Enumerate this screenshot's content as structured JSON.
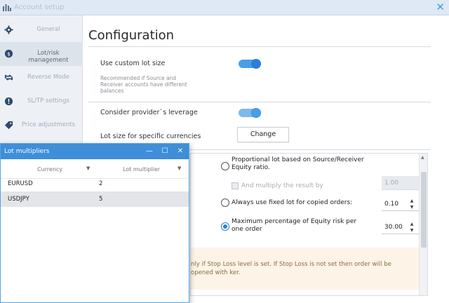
{
  "window": {
    "title": "Account setup",
    "close_glyph": "✕",
    "app_icon": "bars-logo-icon",
    "close_color": "#39a0f0"
  },
  "sidebar": {
    "items": [
      {
        "label": "General",
        "icon": "gear-icon"
      },
      {
        "label": "Lot/risk management",
        "icon": "dollar-coin-icon",
        "active": true
      },
      {
        "label": "Reverse Mode",
        "icon": "reverse-arrows-icon"
      },
      {
        "label": "SL/TP settings",
        "icon": "alert-circle-icon"
      },
      {
        "label": "Price adjustments",
        "icon": "tag-icon"
      }
    ]
  },
  "main": {
    "title": "Configuration",
    "use_custom_lot": {
      "label": "Use custom lot size",
      "hint": "Recommended if Source and Receiver accounts have different balances",
      "enabled": true
    },
    "provider_leverage": {
      "label": "Consider provider`s leverage",
      "enabled": true
    },
    "specific_currencies": {
      "label": "Lot size for specific currencies",
      "button": "Change"
    },
    "lot_options": {
      "proportional": {
        "label": "Proportional lot based on Source/Receiver Equity ratio.",
        "selected": false
      },
      "multiply": {
        "label": "And multiply the result by",
        "value": "1.00",
        "checked": false,
        "disabled": true
      },
      "fixed": {
        "label": "Always use fixed lot for copied orders:",
        "value": "0.10",
        "selected": false
      },
      "max_risk": {
        "label": "Maximum percentage of Equity risk per one order",
        "value": "30.00",
        "selected": true
      },
      "warning": "nly if Stop Loss level is set. If Stop Loss is not set then order will be opened with ker."
    },
    "accent_color": "#2c7fd6"
  },
  "lot_multipliers": {
    "title": "Lot multipliers",
    "controls": {
      "minimize": "—",
      "maximize": "☐",
      "close": "✕"
    },
    "columns": [
      "Currency",
      "Lot multiplier"
    ],
    "sort_glyph": "▼",
    "rows": [
      {
        "currency": "EURUSD",
        "multiplier": "2"
      },
      {
        "currency": "USDJPY",
        "multiplier": "5",
        "selected": true
      }
    ],
    "title_color": "#3e8ed9"
  }
}
